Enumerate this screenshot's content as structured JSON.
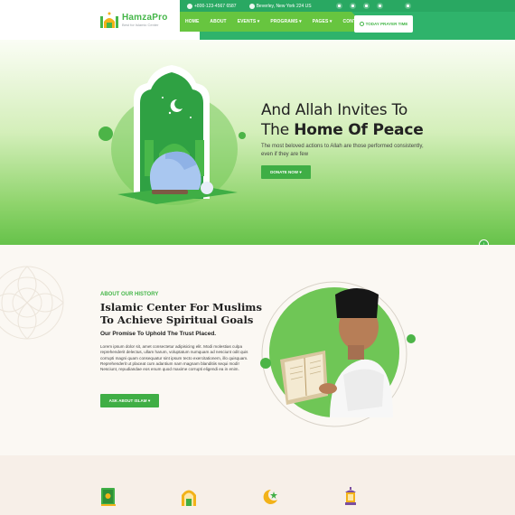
{
  "brand": {
    "name": "HamzaPro",
    "tagline": "Best for Islamic Center"
  },
  "topbar": {
    "phone": "+800-123-4567 6587",
    "address": "Beverley, New York 224 US",
    "social_icons": [
      "dribbble-icon",
      "twitter-icon",
      "vimeo-icon",
      "skype-icon",
      "wifi-icon"
    ]
  },
  "nav": {
    "items": [
      "HOME",
      "ABOUT",
      "EVENTS ▾",
      "PROGRAMS ▾",
      "PAGES ▾",
      "CONTACT"
    ],
    "prayer_button": "TODAY PRAYER TIME"
  },
  "hero": {
    "title_line1": "And Allah Invites To",
    "title_line2_prefix": "The ",
    "title_line2_bold": "Home Of Peace",
    "description": "The most beloved actions to Allah are those performed consistently, even if they are few",
    "button": "DONATE NOW ♥"
  },
  "about": {
    "eyebrow": "ABOUT OUR HISTORY",
    "title": "Islamic Center For Muslims To Achieve Spiritual Goals",
    "subtitle": "Our Promise To Uphold The Trust Placed.",
    "body": "Lorem ipsum dolor sit, amet consectetur adipisicing elit. Modi molestias culpa reprehenderit delectus, ullam harum, voluptatum numquam ad nesciunt odit quis corrupti magni quam consequatur sint ipsum tecto exercitationem, illo quisquam. Reprehenderit ut placeat cum adantium nam magnam blanditiis sequi modi! Nesciunt, repudiandae eos enum quod maxime corrupti eligendi ea in enim.",
    "button": "ASK ABOUT ISLAM ♥"
  },
  "features": {
    "icons": [
      "quran-book-icon",
      "mosque-window-icon",
      "crescent-star-icon",
      "lantern-icon"
    ]
  },
  "colors": {
    "primary_green": "#45b649",
    "dark_green": "#3fae45",
    "text_dark": "#1e1e1e"
  }
}
